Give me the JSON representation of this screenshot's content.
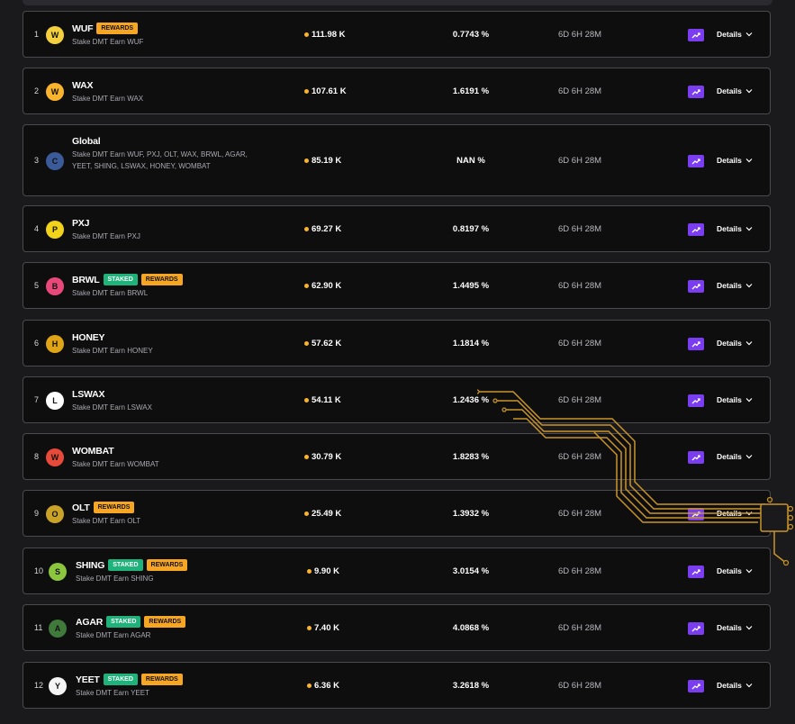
{
  "pools": [
    {
      "rank": "1",
      "name": "WUF",
      "badges": [
        "REWARDS"
      ],
      "subtitle": "Stake DMT Earn WUF",
      "tvl": "111.98 K",
      "apr": "0.7743 %",
      "time": "6D 6H 28M",
      "details": "Details",
      "logo_color": "#f4d03f",
      "logo_glyph": "W"
    },
    {
      "rank": "2",
      "name": "WAX",
      "badges": [],
      "subtitle": "Stake DMT Earn WAX",
      "tvl": "107.61 K",
      "apr": "1.6191 %",
      "time": "6D 6H 28M",
      "details": "Details",
      "logo_color": "#f7b42c",
      "logo_glyph": "W"
    },
    {
      "rank": "3",
      "name": "Global",
      "badges": [],
      "subtitle": "Stake DMT Earn WUF, PXJ, OLT, WAX, BRWL, AGAR, YEET, SHING, LSWAX, HONEY, WOMBAT",
      "tvl": "85.19 K",
      "apr": "NAN %",
      "time": "6D 6H 28M",
      "details": "Details",
      "logo_color": "#3b5a9a",
      "logo_glyph": "C"
    },
    {
      "rank": "4",
      "name": "PXJ",
      "badges": [],
      "subtitle": "Stake DMT Earn PXJ",
      "tvl": "69.27 K",
      "apr": "0.8197 %",
      "time": "6D 6H 28M",
      "details": "Details",
      "logo_color": "#f2d21b",
      "logo_glyph": "P"
    },
    {
      "rank": "5",
      "name": "BRWL",
      "badges": [
        "STAKED",
        "REWARDS"
      ],
      "subtitle": "Stake DMT Earn BRWL",
      "tvl": "62.90 K",
      "apr": "1.4495 %",
      "time": "6D 6H 28M",
      "details": "Details",
      "logo_color": "#e8497a",
      "logo_glyph": "B"
    },
    {
      "rank": "6",
      "name": "HONEY",
      "badges": [],
      "subtitle": "Stake DMT Earn HONEY",
      "tvl": "57.62 K",
      "apr": "1.1814 %",
      "time": "6D 6H 28M",
      "details": "Details",
      "logo_color": "#e0a417",
      "logo_glyph": "H"
    },
    {
      "rank": "7",
      "name": "LSWAX",
      "badges": [],
      "subtitle": "Stake DMT Earn LSWAX",
      "tvl": "54.11 K",
      "apr": "1.2436 %",
      "time": "6D 6H 28M",
      "details": "Details",
      "logo_color": "#ffffff",
      "logo_glyph": "L"
    },
    {
      "rank": "8",
      "name": "WOMBAT",
      "badges": [],
      "subtitle": "Stake DMT Earn WOMBAT",
      "tvl": "30.79 K",
      "apr": "1.8283 %",
      "time": "6D 6H 28M",
      "details": "Details",
      "logo_color": "#e84a3a",
      "logo_glyph": "W"
    },
    {
      "rank": "9",
      "name": "OLT",
      "badges": [
        "REWARDS"
      ],
      "subtitle": "Stake DMT Earn OLT",
      "tvl": "25.49 K",
      "apr": "1.3932 %",
      "time": "6D 6H 28M",
      "details": "Details",
      "logo_color": "#c9a227",
      "logo_glyph": "O"
    },
    {
      "rank": "10",
      "name": "SHING",
      "badges": [
        "STAKED",
        "REWARDS"
      ],
      "subtitle": "Stake DMT Earn SHING",
      "tvl": "9.90 K",
      "apr": "3.0154 %",
      "time": "6D 6H 28M",
      "details": "Details",
      "logo_color": "#8cc63f",
      "logo_glyph": "S"
    },
    {
      "rank": "11",
      "name": "AGAR",
      "badges": [
        "STAKED",
        "REWARDS"
      ],
      "subtitle": "Stake DMT Earn AGAR",
      "tvl": "7.40 K",
      "apr": "4.0868 %",
      "time": "6D 6H 28M",
      "details": "Details",
      "logo_color": "#3f7a3a",
      "logo_glyph": "A"
    },
    {
      "rank": "12",
      "name": "YEET",
      "badges": [
        "STAKED",
        "REWARDS"
      ],
      "subtitle": "Stake DMT Earn YEET",
      "tvl": "6.36 K",
      "apr": "3.2618 %",
      "time": "6D 6H 28M",
      "details": "Details",
      "logo_color": "#f5f5f5",
      "logo_glyph": "Y"
    }
  ],
  "colors": {
    "accent": "#7b3df0",
    "staked": "#1fb27a",
    "rewards": "#f6a623",
    "circuit": "#c9952a"
  },
  "icons": {
    "action": "trend-up-icon",
    "chevron": "chevron-down-icon"
  }
}
